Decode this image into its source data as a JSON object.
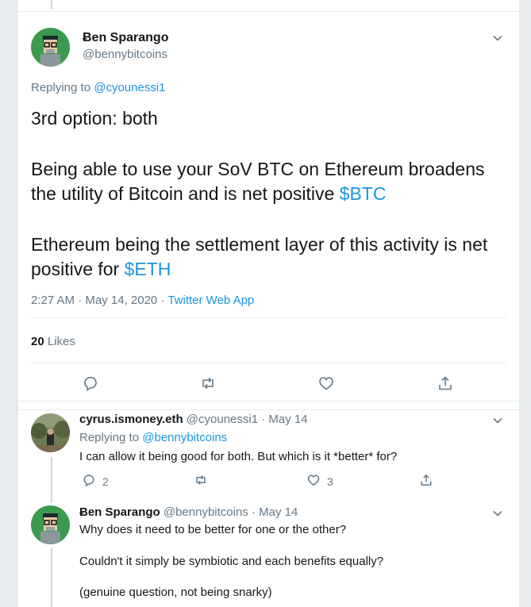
{
  "main_tweet": {
    "display_name": "Ƀen Sparango",
    "handle": "@bennybitcoins",
    "replying_prefix": "Replying to",
    "replying_to": "@cyounessi1",
    "paragraph1": "3rd option: both",
    "paragraph2_text": "Being able to use your SoV BTC on Ethereum broadens the utility of Bitcoin and is net positive ",
    "paragraph2_cashtag": "$BTC",
    "paragraph3_text": "Ethereum being the settlement layer of this activity is net positive for ",
    "paragraph3_cashtag": "$ETH",
    "timestamp": "2:27 AM · May 14, 2020 · ",
    "source": "Twitter Web App",
    "likes_count": "20",
    "likes_label": "Likes"
  },
  "reply1": {
    "display_name": "cyrus.ismoney.eth",
    "handle_date": "@cyounessi1 · May 14",
    "replying_prefix": "Replying to",
    "replying_to": "@bennybitcoins",
    "text": "I can allow it being good for both. But which is it *better* for?",
    "reply_count": "2",
    "like_count": "3"
  },
  "reply2": {
    "display_name": "Ƀen Sparango",
    "handle_date": "@bennybitcoins · May 14",
    "line1": "Why does it need to be better for one or the other?",
    "line2": "Couldn't it simply be symbiotic and each benefits equally?",
    "line3": "(genuine question, not being snarky)"
  },
  "icons": {
    "main_actions": [
      "reply-icon",
      "retweet-icon",
      "like-icon",
      "share-icon"
    ],
    "menu": "chevron-down-icon"
  },
  "colors": {
    "link": "#1b95e0",
    "muted": "#657786",
    "border": "#e6ecf0"
  }
}
